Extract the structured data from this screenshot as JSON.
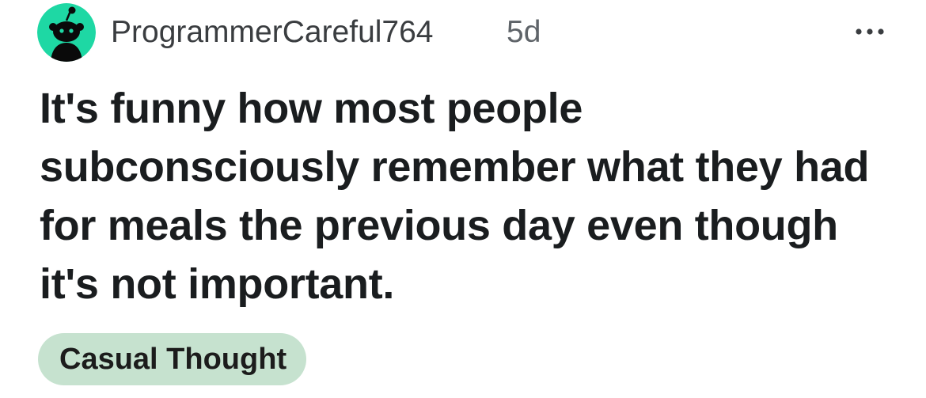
{
  "post": {
    "author": {
      "username": "ProgrammerCareful764",
      "avatar_icon": "snoo-avatar-icon",
      "avatar_color": "#1ed8a4"
    },
    "time_ago": "5d",
    "more_icon": "more-options-icon",
    "title": "It's funny how most people subconsciously remember what they had for meals the previous day even though it's not important.",
    "flair": {
      "label": "Casual Thought",
      "background": "#c6e2cf"
    }
  }
}
